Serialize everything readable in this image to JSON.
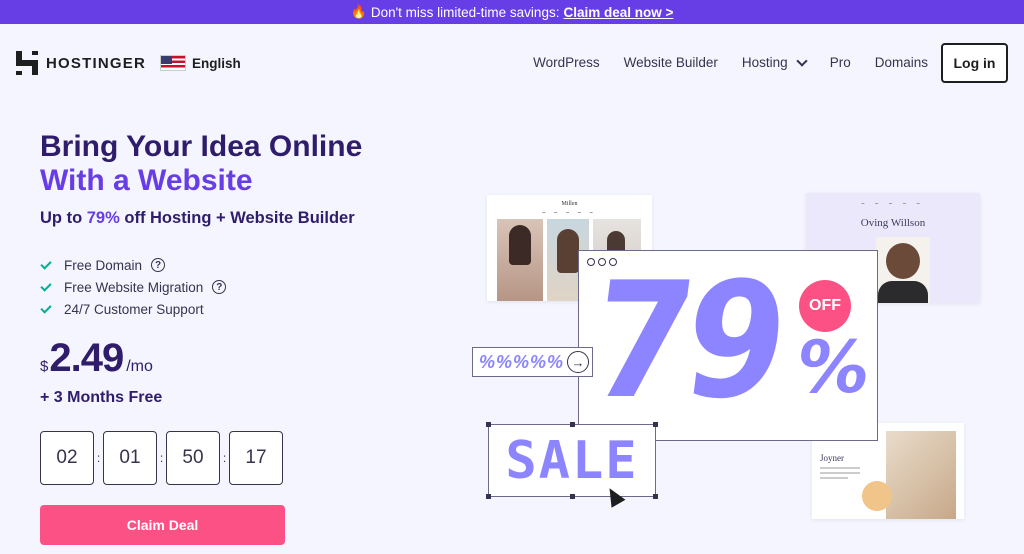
{
  "promo_bar": {
    "emoji": "🔥",
    "text": "Don't miss limited-time savings:",
    "cta": "Claim deal now >"
  },
  "header": {
    "brand": "HOSTINGER",
    "language": "English",
    "menu": [
      "WordPress",
      "Website Builder",
      "Hosting",
      "Pro",
      "Domains"
    ],
    "login": "Log in"
  },
  "hero": {
    "title_line1": "Bring Your Idea Online",
    "title_line2": "With a Website",
    "sub_prefix": "Up to ",
    "sub_pct": "79%",
    "sub_suffix": " off Hosting + Website Builder",
    "features": [
      "Free Domain",
      "Free Website Migration",
      "24/7 Customer Support"
    ],
    "currency": "$",
    "price": "2.49",
    "period": "/mo",
    "bonus": "+ 3 Months Free",
    "timer": [
      "02",
      "01",
      "50",
      "17"
    ],
    "claim": "Claim Deal"
  },
  "visual": {
    "card1_title": "Millen",
    "card2_title": "Oving Willson",
    "card3_title": "Joyner",
    "big_number": "79",
    "big_pct": "%",
    "off": "OFF",
    "pct_strip": "%%%%%",
    "sale": "SALE"
  },
  "colors": {
    "brand": "#673de6",
    "accent_pink": "#fc5185",
    "graphic_purple": "#8c85ff",
    "check_green": "#00b090"
  }
}
